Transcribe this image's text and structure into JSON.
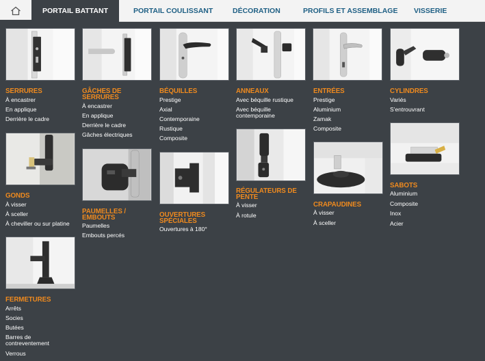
{
  "nav": {
    "home_icon": "home-icon",
    "tabs": [
      {
        "label": "PORTAIL BATTANT",
        "active": true
      },
      {
        "label": "PORTAIL COULISSANT",
        "active": false
      },
      {
        "label": "DÉCORATION",
        "active": false
      },
      {
        "label": "PROFILS ET ASSEMBLAGE",
        "active": false
      },
      {
        "label": "VISSERIE",
        "active": false
      }
    ]
  },
  "colors": {
    "panel_bg": "#3c4146",
    "accent": "#ef8a1e",
    "nav_text": "#1e5f84",
    "link_text": "#ffffff"
  },
  "menu": {
    "serrures": {
      "title": "SERRURES",
      "items": [
        "À encastrer",
        "En applique",
        "Derrière le cadre"
      ]
    },
    "gaches": {
      "title": "GÂCHES DE SERRURES",
      "items": [
        "À encastrer",
        "En applique",
        "Derrière le cadre",
        "Gâches électriques"
      ]
    },
    "bequilles": {
      "title": "BÉQUILLES",
      "items": [
        "Prestige",
        "Axial",
        "Contemporaine",
        "Rustique",
        "Composite"
      ]
    },
    "anneaux": {
      "title": "ANNEAUX",
      "items": [
        "Avec béquille rustique",
        "Avec béquille contemporaine"
      ]
    },
    "entrees": {
      "title": "ENTRÉES",
      "items": [
        "Prestige",
        "Aluminium",
        "Zamak",
        "Composite"
      ]
    },
    "cylindres": {
      "title": "CYLINDRES",
      "items": [
        "Variés",
        "S'entrouvrant"
      ]
    },
    "gonds": {
      "title": "GONDS",
      "items": [
        "À visser",
        "À sceller",
        "À cheviller ou sur platine"
      ]
    },
    "paumelles": {
      "title": "PAUMELLES / EMBOUTS",
      "items": [
        "Paumelles",
        "Embouts percés"
      ]
    },
    "ouvertures": {
      "title": "OUVERTURES SPÉCIALES",
      "items": [
        "Ouvertures à 180°"
      ]
    },
    "regulateurs": {
      "title": "RÉGULATEURS DE PENTE",
      "items": [
        "À visser",
        "À rotule"
      ]
    },
    "crapaudines": {
      "title": "CRAPAUDINES",
      "items": [
        "À visser",
        "À sceller"
      ]
    },
    "sabots": {
      "title": "SABOTS",
      "items": [
        "Aluminium",
        "Composite",
        "Inox",
        "Acier"
      ]
    },
    "fermetures": {
      "title": "FERMETURES",
      "items": [
        "Arrêts",
        "Socies",
        "Butées",
        "Barres de contreventement",
        "Verrous"
      ]
    }
  }
}
